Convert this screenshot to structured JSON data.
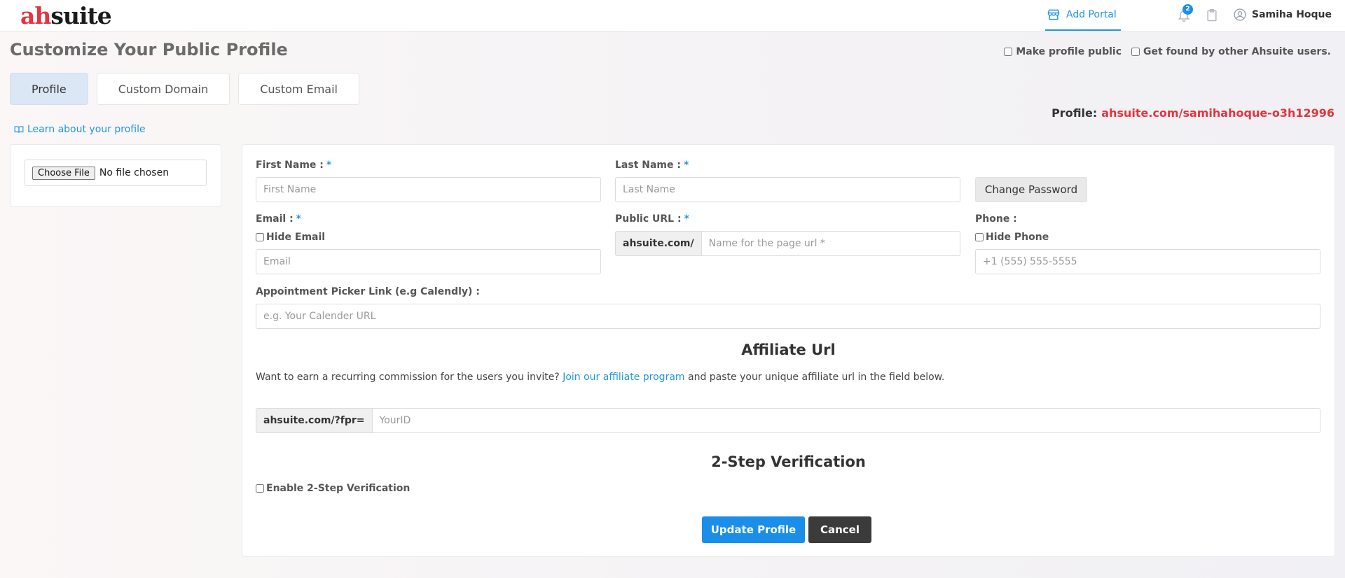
{
  "header": {
    "logo_prefix": "ah",
    "logo_suffix": "suite",
    "add_portal": "Add Portal",
    "notification_count": "2",
    "user_name": "Samiha Hoque"
  },
  "page": {
    "title": "Customize Your Public Profile",
    "make_public": "Make profile public",
    "get_found": "Get found by other Ahsuite users.",
    "profile_label": "Profile:",
    "profile_url": "ahsuite.com/samihahoque-o3h12996",
    "learn_link": "Learn about your profile"
  },
  "tabs": [
    {
      "label": "Profile"
    },
    {
      "label": "Custom Domain"
    },
    {
      "label": "Custom Email"
    }
  ],
  "file": {
    "button": "Choose File",
    "status": "No file chosen"
  },
  "form": {
    "first_name_label": "First Name :",
    "first_name_placeholder": "First Name",
    "last_name_label": "Last Name :",
    "last_name_placeholder": "Last Name",
    "change_password": "Change Password",
    "email_label": "Email :",
    "hide_email": "Hide Email",
    "email_placeholder": "Email",
    "public_url_label": "Public URL :",
    "public_url_prefix": "ahsuite.com/",
    "public_url_placeholder": "Name for the page url *",
    "phone_label": "Phone :",
    "hide_phone": "Hide Phone",
    "phone_placeholder": "+1 (555) 555-5555",
    "appointment_label": "Appointment Picker Link (e.g Calendly) :",
    "appointment_placeholder": "e.g. Your Calender URL",
    "required_mark": "*"
  },
  "affiliate": {
    "title": "Affiliate Url",
    "text_before": "Want to earn a recurring commission for the users you invite?",
    "link": "Join our affiliate program",
    "text_after": "and paste your unique affiliate url in the field below.",
    "prefix": "ahsuite.com/?fpr=",
    "placeholder": "YourID"
  },
  "two_step": {
    "title": "2-Step Verification",
    "enable": "Enable 2-Step Verification"
  },
  "actions": {
    "update": "Update Profile",
    "cancel": "Cancel"
  }
}
